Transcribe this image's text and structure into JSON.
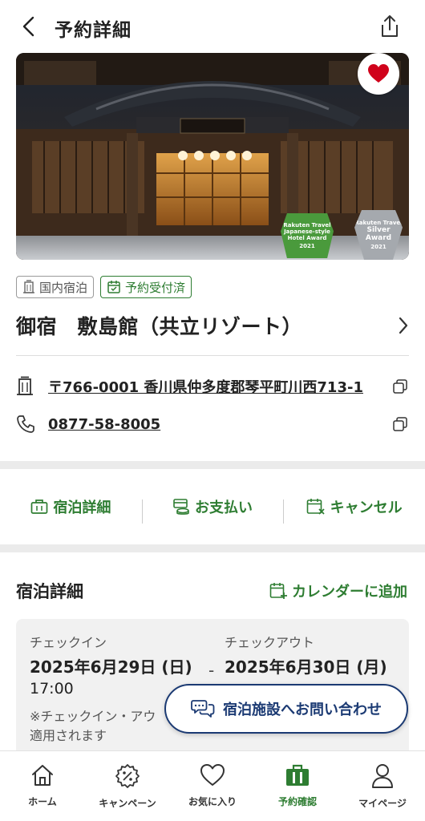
{
  "header": {
    "title": "予約詳細"
  },
  "hero": {
    "awards": [
      {
        "line1": "Rakuten Travel",
        "line2": "Japanese-style",
        "line3": "Hotel Award",
        "year": "2021"
      },
      {
        "line1": "Rakuten Travel",
        "line2": "Silver",
        "line3": "Award",
        "year": "2021"
      }
    ]
  },
  "tags": {
    "category": "国内宿泊",
    "status": "予約受付済"
  },
  "hotel": {
    "name": "御宿　敷島館（共立リゾート）",
    "address": "〒766-0001 香川県仲多度郡琴平町川西713-1",
    "phone": "0877-58-8005"
  },
  "actions": {
    "stay_details": "宿泊詳細",
    "payment": "お支払い",
    "cancel": "キャンセル"
  },
  "stay": {
    "section_title": "宿泊詳細",
    "add_calendar": "カレンダーに追加",
    "checkin_label": "チェックイン",
    "checkin_date": "2025年6月29日 (日)",
    "checkin_time": "17:00",
    "checkout_label": "チェックアウト",
    "checkout_date": "2025年6月30日 (月)",
    "separator": "-",
    "note": "※チェックイン・アウ",
    "note2": "適用されます"
  },
  "contact_button": "宿泊施設へお問い合わせ",
  "tabbar": {
    "items": [
      {
        "label": "ホーム",
        "icon": "home-icon"
      },
      {
        "label": "キャンペーン",
        "icon": "campaign-percent-icon"
      },
      {
        "label": "お気に入り",
        "icon": "heart-icon"
      },
      {
        "label": "予約確認",
        "icon": "reservation-bag-icon"
      },
      {
        "label": "マイページ",
        "icon": "person-icon"
      }
    ],
    "active_index": 3
  },
  "colors": {
    "accent_green": "#2e7d32",
    "navy": "#1b3a73",
    "heart_red": "#d0021b"
  }
}
